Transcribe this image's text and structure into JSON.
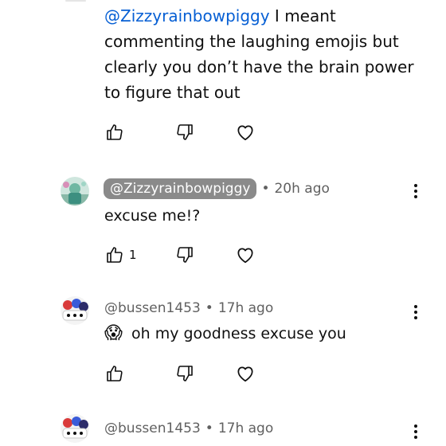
{
  "reply_top": {
    "mention": "@Zizzyrainbowpiggy",
    "text": " I meant commenting the laughing emojis but clearly you don’t have the brain power to figure that out"
  },
  "comments": [
    {
      "handle": "@Zizzyrainbowpiggy",
      "separator": "•",
      "time": "20h ago",
      "text": "excuse me!?",
      "likes": "1"
    },
    {
      "handle": "@bussen1453",
      "separator": "•",
      "time": "17h ago",
      "emoji": "😱",
      "text": "oh my goodness excuse you"
    },
    {
      "handle": "@bussen1453",
      "separator": "•",
      "time": "17h ago"
    }
  ],
  "icons": {
    "like": "thumbs-up-icon",
    "dislike": "thumbs-down-icon",
    "heart": "heart-icon",
    "more": "more-vertical-icon"
  }
}
